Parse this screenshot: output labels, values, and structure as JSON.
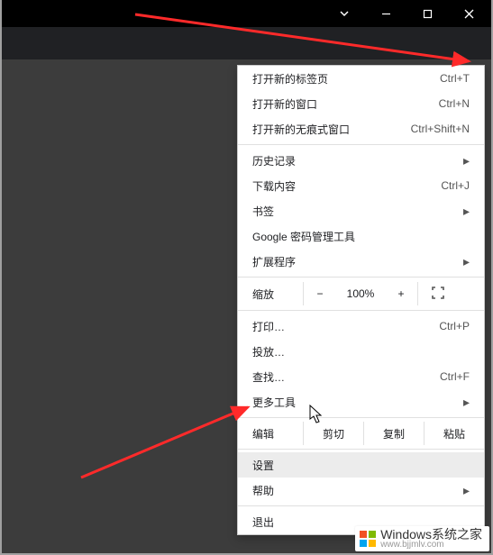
{
  "colors": {
    "arrow": "#ff2a2a"
  },
  "menu": {
    "new_tab": {
      "label": "打开新的标签页",
      "shortcut": "Ctrl+T"
    },
    "new_window": {
      "label": "打开新的窗口",
      "shortcut": "Ctrl+N"
    },
    "new_incognito": {
      "label": "打开新的无痕式窗口",
      "shortcut": "Ctrl+Shift+N"
    },
    "history": {
      "label": "历史记录"
    },
    "downloads": {
      "label": "下载内容",
      "shortcut": "Ctrl+J"
    },
    "bookmarks": {
      "label": "书签"
    },
    "password_manager": {
      "label": "Google 密码管理工具"
    },
    "extensions": {
      "label": "扩展程序"
    },
    "zoom": {
      "label": "缩放",
      "minus": "−",
      "value": "100%",
      "plus": "+"
    },
    "print": {
      "label": "打印…",
      "shortcut": "Ctrl+P"
    },
    "cast": {
      "label": "投放…"
    },
    "find": {
      "label": "查找…",
      "shortcut": "Ctrl+F"
    },
    "more_tools": {
      "label": "更多工具"
    },
    "edit": {
      "label": "编辑",
      "cut": "剪切",
      "copy": "复制",
      "paste": "粘贴"
    },
    "settings": {
      "label": "设置"
    },
    "help": {
      "label": "帮助"
    },
    "exit": {
      "label": "退出"
    }
  },
  "watermark": {
    "title": "Windows系统之家",
    "url": "www.bjjmlv.com"
  }
}
